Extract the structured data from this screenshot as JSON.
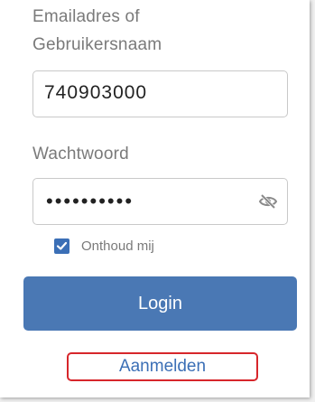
{
  "form": {
    "username_label": "Emailadres of Gebruikersnaam",
    "username_value": "740903000",
    "password_label": "Wachtwoord",
    "password_value": "••••••••••",
    "password_visibility_icon": "eye-slash-icon",
    "remember_label": "Onthoud mij",
    "remember_checked": true,
    "login_label": "Login",
    "register_label": "Aanmelden"
  },
  "colors": {
    "primary": "#4a78b4",
    "checkbox": "#3b6fb6",
    "link": "#3b6fb6",
    "highlight_border": "#d7262b",
    "label_text": "#7a7a7a"
  }
}
